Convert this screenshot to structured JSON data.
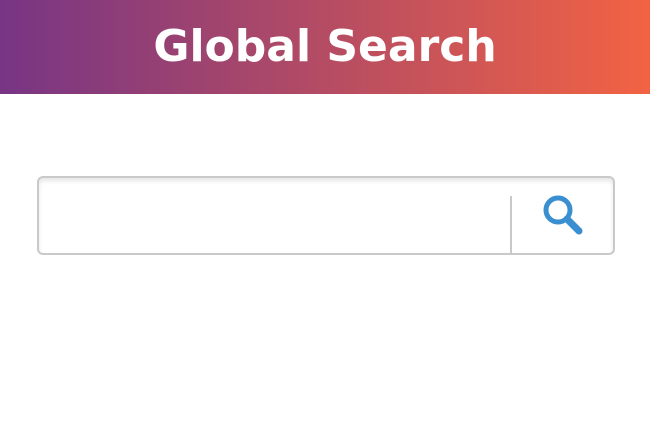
{
  "header": {
    "title": "Global Search",
    "gradient_start": "#773584",
    "gradient_end": "#f26343"
  },
  "search": {
    "value": "",
    "placeholder": "",
    "button_icon": "magnifier-icon",
    "icon_color": "#3a8fd0"
  }
}
